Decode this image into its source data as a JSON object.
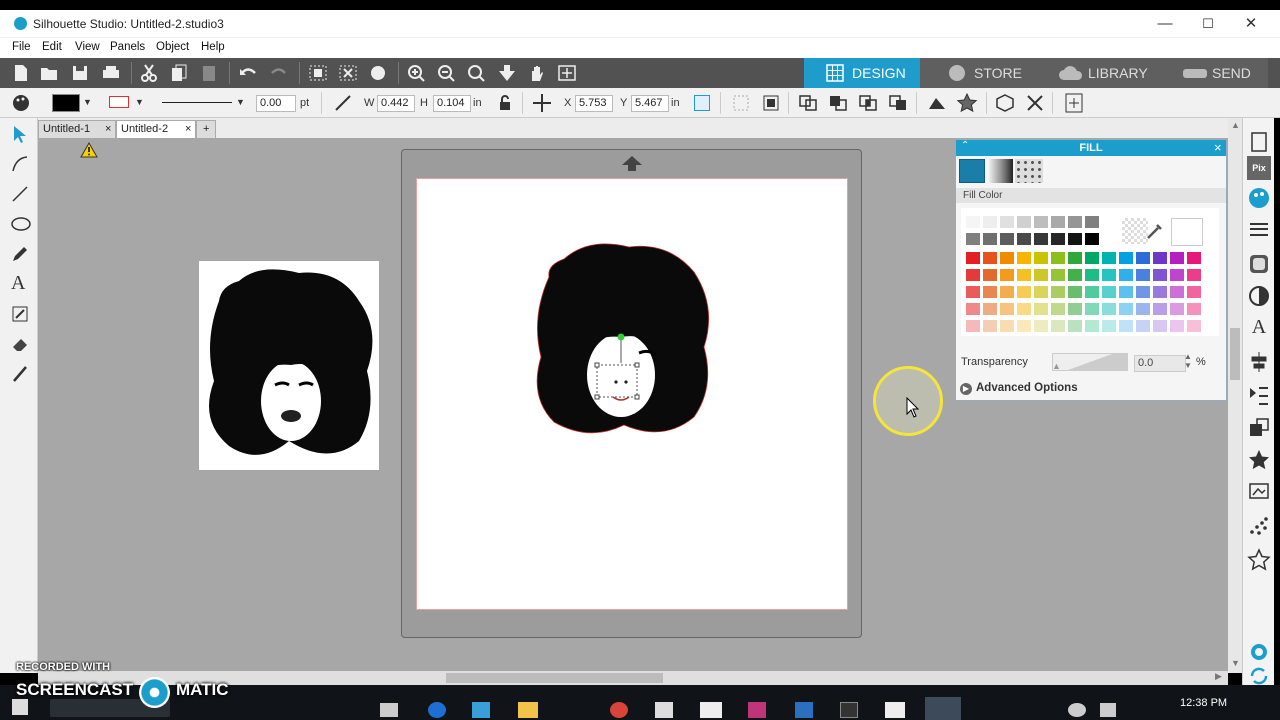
{
  "window": {
    "title": "Silhouette Studio: Untitled-2.studio3",
    "minimize": "—",
    "maximize": "☐",
    "close": "✕"
  },
  "menu": [
    "File",
    "Edit",
    "View",
    "Panels",
    "Object",
    "Help"
  ],
  "modes": {
    "design": "DESIGN",
    "store": "STORE",
    "library": "LIBRARY",
    "send": "SEND"
  },
  "line": {
    "width_value": "0.00",
    "width_unit": "pt"
  },
  "size": {
    "w_label": "W",
    "w_value": "0.442",
    "h_label": "H",
    "h_value": "0.104",
    "unit": "in"
  },
  "position": {
    "x_label": "X",
    "x_value": "5.753",
    "y_label": "Y",
    "y_value": "5.467",
    "unit": "in"
  },
  "tabs": [
    {
      "label": "Untitled-1",
      "close": "×"
    },
    {
      "label": "Untitled-2",
      "close": "×"
    }
  ],
  "new_tab": "+",
  "fill": {
    "title": "FILL",
    "section": "Fill Color",
    "close": "×",
    "transparency_label": "Transparency",
    "transparency_value": "0.0",
    "transparency_unit": "%",
    "advanced_label": "Advanced Options",
    "grays": [
      "#f5f5f5",
      "#eeeeee",
      "#e0e0e0",
      "#d0d0d0",
      "#bdbdbd",
      "#a9a9a9",
      "#959595",
      "#808080",
      "#707070",
      "#5d5d5d",
      "#4a4a4a",
      "#383838",
      "#262626",
      "#141414",
      "#000000"
    ],
    "colors": [
      [
        "#e31e24",
        "#e8511b",
        "#f28a00",
        "#f7b400",
        "#c9c300",
        "#8dbf1c",
        "#2fa839",
        "#00a867",
        "#00b3b0",
        "#00a1e4",
        "#2c6bd8",
        "#6d38c8",
        "#b51fc1",
        "#e6187a"
      ],
      [
        "#e33a3a",
        "#e26a2c",
        "#f39a1f",
        "#f5bf26",
        "#cfc729",
        "#97c337",
        "#43b04a",
        "#1ebd85",
        "#27c3c1",
        "#30b0ea",
        "#4b7fe0",
        "#8055d4",
        "#c045cc",
        "#ec3d8d"
      ],
      [
        "#ea5c5c",
        "#e8874f",
        "#f5ac4a",
        "#f7cc55",
        "#dad55a",
        "#abcc5e",
        "#68be6c",
        "#4fcb9e",
        "#58d0ce",
        "#5dc1ef",
        "#7097e7",
        "#9a79de",
        "#cf6ed8",
        "#f0659f"
      ],
      [
        "#f08a8a",
        "#eeab84",
        "#f7c47d",
        "#f9da87",
        "#e4e18d",
        "#c1d98d",
        "#90cf94",
        "#81dab7",
        "#89dddc",
        "#8dd2f4",
        "#9bb5ef",
        "#b89fe8",
        "#dc9ae3",
        "#f592bc"
      ],
      [
        "#f6b9b9",
        "#f4cdb3",
        "#f9dcb0",
        "#fbe9b9",
        "#eeecbe",
        "#d9e8bd",
        "#bae2be",
        "#b3e9d2",
        "#b8ebea",
        "#bce3f8",
        "#c5d4f6",
        "#d6c8f2",
        "#ebc5ee",
        "#f9bfd8"
      ]
    ]
  },
  "watermark": {
    "line1": "RECORDED WITH",
    "line2a": "SCREENCAST",
    "line2b": "MATIC"
  },
  "clock": "12:38 PM"
}
